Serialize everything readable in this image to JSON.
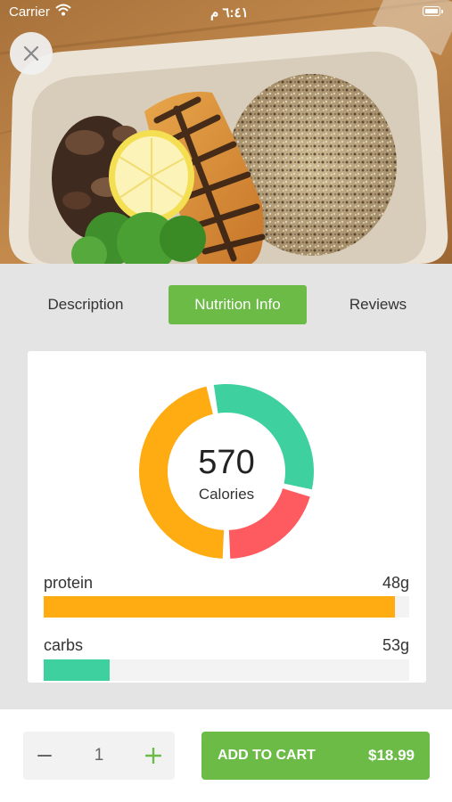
{
  "status_bar": {
    "carrier": "Carrier",
    "time": "٦:٤١ م"
  },
  "hero": {
    "icon": "close-icon"
  },
  "tabs": [
    {
      "label": "Description",
      "active": false
    },
    {
      "label": "Nutrition Info",
      "active": true
    },
    {
      "label": "Reviews",
      "active": false
    }
  ],
  "nutrition": {
    "calories_value": "570",
    "calories_label": "Calories",
    "chart_data": {
      "type": "pie",
      "style": "donut",
      "segments": [
        {
          "color": "#ffab12",
          "share": 0.47
        },
        {
          "color": "#3fd0a0",
          "share": 0.32
        },
        {
          "color": "#fd5b5f",
          "share": 0.21
        }
      ]
    },
    "macros": [
      {
        "name": "protein",
        "amount": "48g",
        "fill": 0.96,
        "color": "#ffab12"
      },
      {
        "name": "carbs",
        "amount": "53g",
        "fill": 0.18,
        "color": "#3fd0a0"
      }
    ]
  },
  "cart": {
    "quantity": "1",
    "add_label": "ADD TO CART",
    "price": "$18.99",
    "accent": "#6bbb46"
  }
}
